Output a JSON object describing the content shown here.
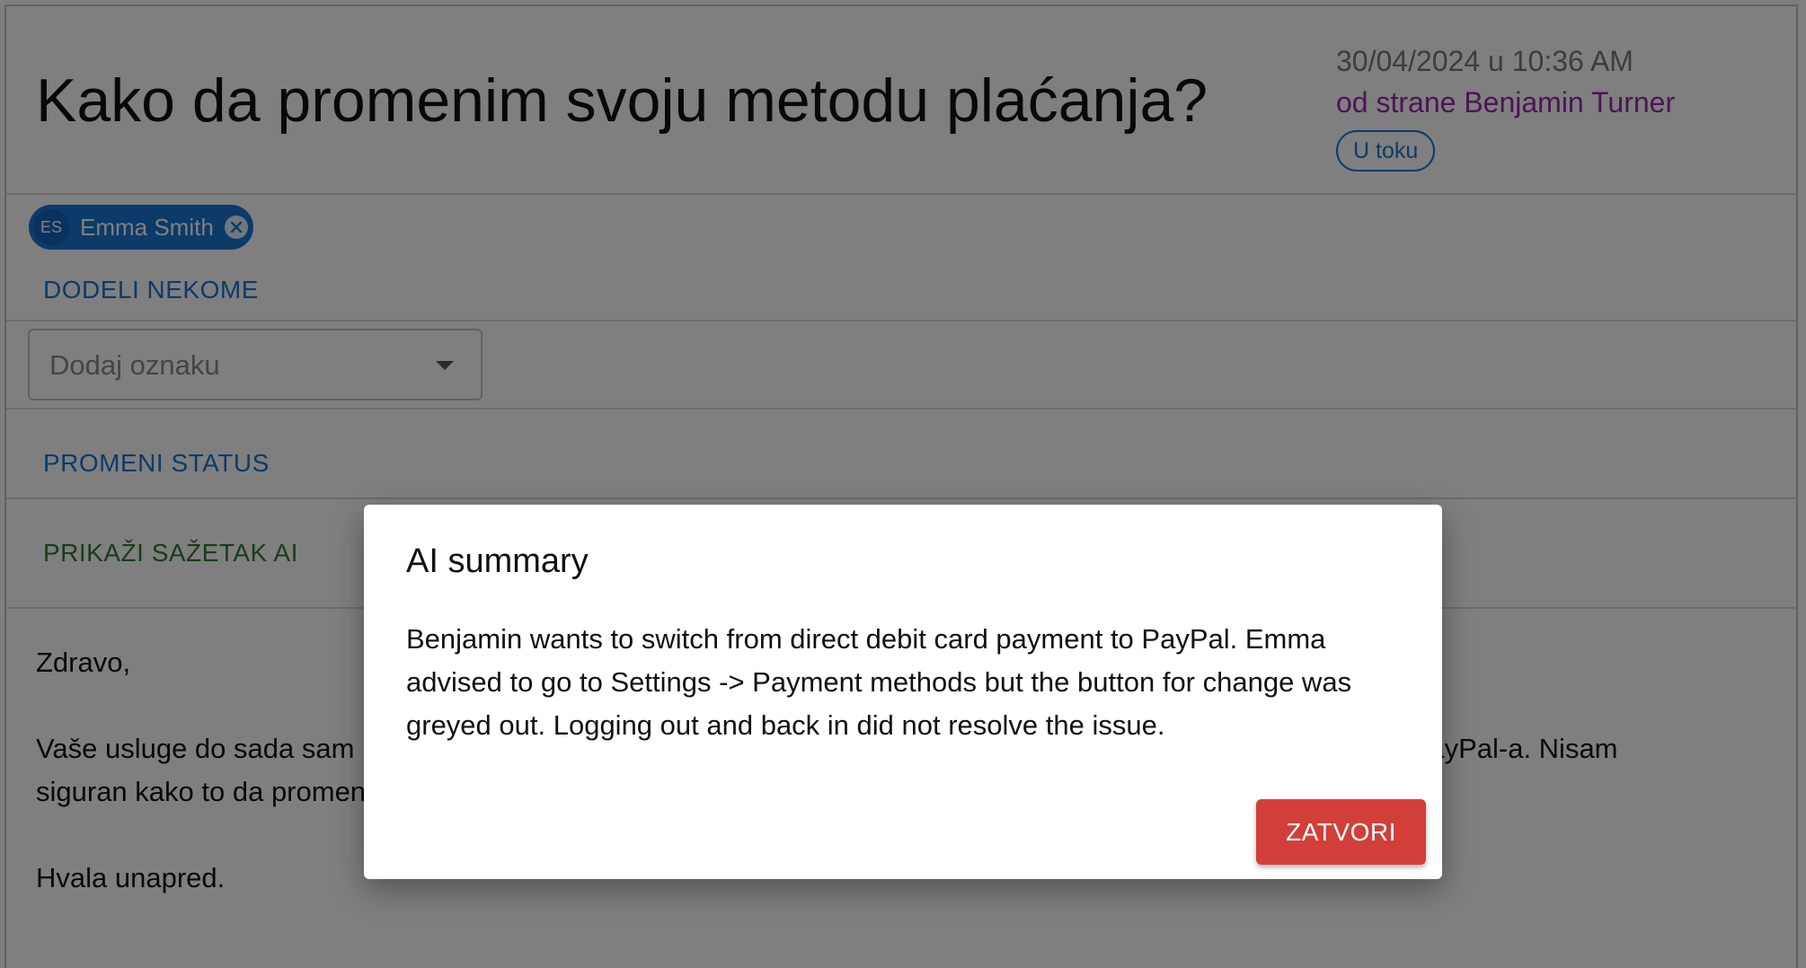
{
  "ticket": {
    "title": "Kako da promenim svoju metodu plaćanja?",
    "date": "30/04/2024 u 10:36 AM",
    "author": "od strane Benjamin Turner",
    "status": "U toku"
  },
  "assignee": {
    "initials": "ES",
    "name": "Emma Smith"
  },
  "actions": {
    "assign_label": "DODELI NEKOME",
    "change_status_label": "PROMENI STATUS",
    "ai_summary_label": "PRIKAŽI SAŽETAK AI"
  },
  "tag_select": {
    "placeholder": "Dodaj oznaku"
  },
  "message": {
    "greeting": "Zdravo,",
    "paragraph": "Vaše usluge do sada sam plaćao direktnim zaduženjem debitne kartice, ali bih voleo da od sada plaćam putem PayPal-a. Nisam siguran kako to da promenim. Možete li mi pomoći?",
    "closing": "Hvala unapred."
  },
  "dialog": {
    "title": "AI summary",
    "body": "Benjamin wants to switch from direct debit card payment to PayPal. Emma advised to go to Settings -> Payment methods but the button for change was greyed out. Logging out and back in did not resolve the issue.",
    "close_label": "ZATVORI"
  },
  "icons": {
    "chip_remove": "close-circle-icon",
    "dropdown": "dropdown-arrow-icon"
  },
  "colors": {
    "primary": "#1976d2",
    "author": "#9c27b0",
    "ai_action": "#2e7d32",
    "close_button": "#d23f39"
  }
}
